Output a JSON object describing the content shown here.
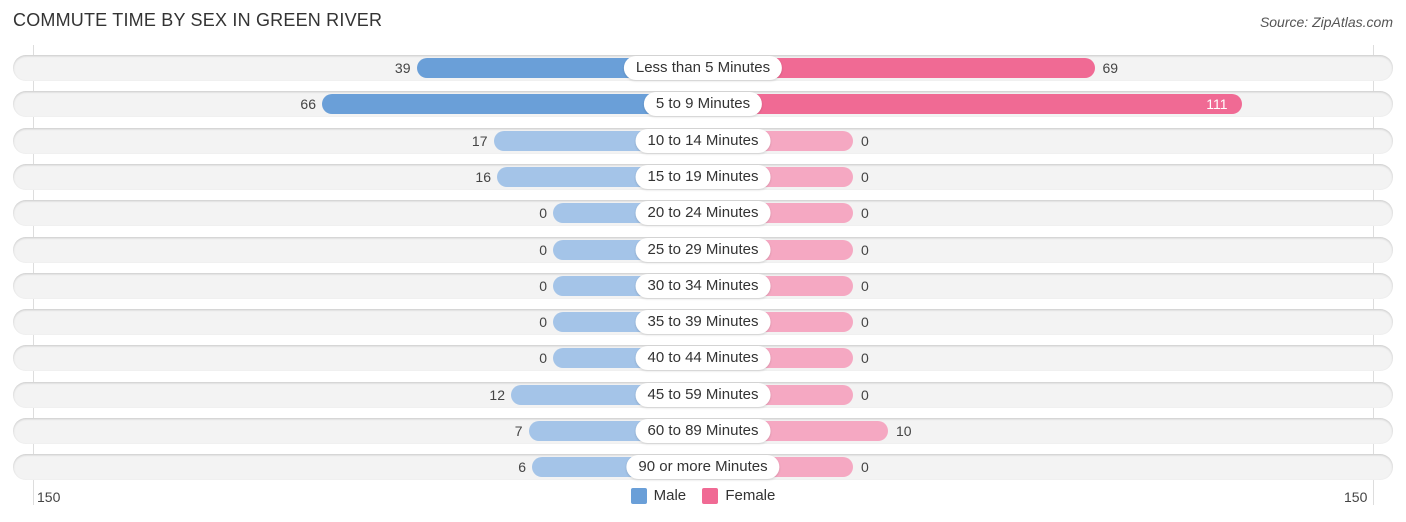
{
  "header": {
    "title": "COMMUTE TIME BY SEX IN GREEN RIVER",
    "source": "Source: ZipAtlas.com"
  },
  "colors": {
    "male": "#6a9fd8",
    "male_light": "#a4c4e8",
    "female": "#f06a94",
    "female_light": "#f5a8c2"
  },
  "axis": {
    "left_label": "150",
    "right_label": "150"
  },
  "legend": [
    {
      "label": "Male",
      "color": "#6a9fd8"
    },
    {
      "label": "Female",
      "color": "#f06a94"
    }
  ],
  "chart_data": {
    "type": "bar",
    "orientation": "horizontal-diverging",
    "title": "COMMUTE TIME BY SEX IN GREEN RIVER",
    "categories": [
      "Less than 5 Minutes",
      "5 to 9 Minutes",
      "10 to 14 Minutes",
      "15 to 19 Minutes",
      "20 to 24 Minutes",
      "25 to 29 Minutes",
      "30 to 34 Minutes",
      "35 to 39 Minutes",
      "40 to 44 Minutes",
      "45 to 59 Minutes",
      "60 to 89 Minutes",
      "90 or more Minutes"
    ],
    "series": [
      {
        "name": "Male",
        "values": [
          39,
          66,
          17,
          16,
          0,
          0,
          0,
          0,
          0,
          12,
          7,
          6
        ]
      },
      {
        "name": "Female",
        "values": [
          69,
          111,
          0,
          0,
          0,
          0,
          0,
          0,
          0,
          0,
          10,
          0
        ]
      }
    ],
    "xlim": [
      -150,
      150
    ],
    "tick_labels": [
      "150",
      "150"
    ],
    "legend_position": "bottom-center",
    "grid": false
  }
}
